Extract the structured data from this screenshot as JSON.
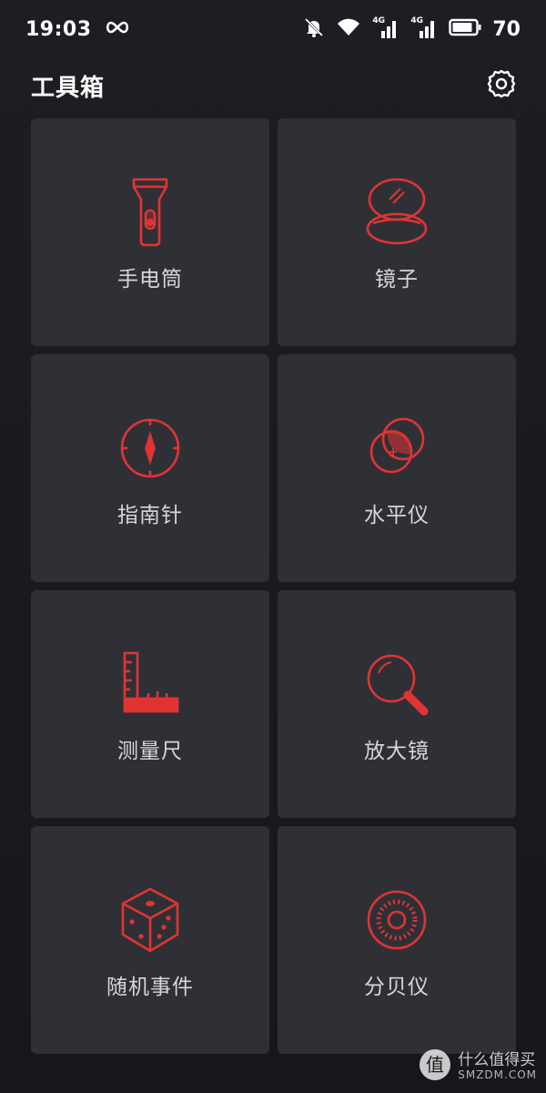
{
  "status_bar": {
    "time": "19:03",
    "battery_percent": "70",
    "network_label_1": "4G",
    "network_label_2": "4G"
  },
  "header": {
    "title": "工具箱"
  },
  "tools": [
    {
      "label": "手电筒",
      "icon": "flashlight-icon"
    },
    {
      "label": "镜子",
      "icon": "mirror-icon"
    },
    {
      "label": "指南针",
      "icon": "compass-icon"
    },
    {
      "label": "水平仪",
      "icon": "level-icon"
    },
    {
      "label": "测量尺",
      "icon": "ruler-icon"
    },
    {
      "label": "放大镜",
      "icon": "magnifier-icon"
    },
    {
      "label": "随机事件",
      "icon": "dice-icon"
    },
    {
      "label": "分贝仪",
      "icon": "decibel-meter-icon"
    }
  ],
  "watermark": {
    "cn": "什么值得买",
    "en": "SMZDM.COM",
    "glyph": "值"
  },
  "colors": {
    "accent": "#e03434",
    "tile_bg": "#2f3036",
    "page_bg": "#1b1c21",
    "label": "#d6d6da"
  }
}
